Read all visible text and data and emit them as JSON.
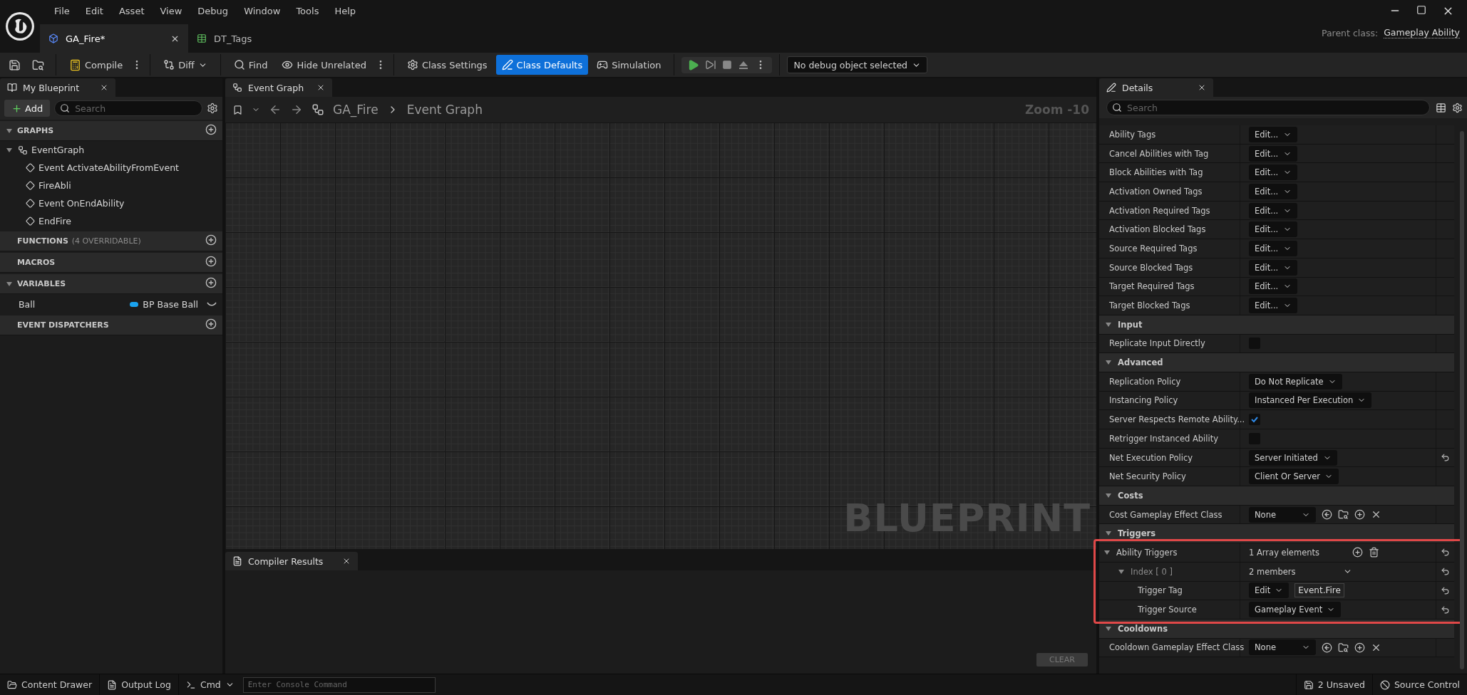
{
  "menu": [
    "File",
    "Edit",
    "Asset",
    "View",
    "Debug",
    "Window",
    "Tools",
    "Help"
  ],
  "doc_tabs": [
    {
      "label": "GA_Fire*",
      "selected": true
    },
    {
      "label": "DT_Tags",
      "selected": false
    }
  ],
  "parent_class": {
    "label": "Parent class:",
    "value": "Gameplay Ability"
  },
  "toolbar": {
    "compile": {
      "label": "Compile",
      "selected": false
    },
    "diff": {
      "label": "Diff",
      "selected": false
    },
    "find": {
      "label": "Find",
      "selected": false
    },
    "hide_unrelated": {
      "label": "Hide Unrelated",
      "selected": false
    },
    "class_settings": {
      "label": "Class Settings",
      "selected": false
    },
    "class_defaults": {
      "label": "Class Defaults",
      "selected": true
    },
    "simulation": {
      "label": "Simulation",
      "selected": false
    },
    "debug_object": "No debug object selected"
  },
  "my_blueprint": {
    "tab": "My Blueprint",
    "add": "Add",
    "search_placeholder": "Search",
    "sections": [
      {
        "title": "GRAPHS",
        "expanded": true,
        "graphs": [
          {
            "label": "EventGraph",
            "expanded": true,
            "children": [
              {
                "label": "Event ActivateAbilityFromEvent"
              },
              {
                "label": "FireAbli"
              },
              {
                "label": "Event OnEndAbility"
              },
              {
                "label": "EndFire"
              }
            ]
          }
        ]
      },
      {
        "title": "FUNCTIONS",
        "note": "(4 OVERRIDABLE)"
      },
      {
        "title": "MACROS"
      },
      {
        "title": "VARIABLES",
        "expanded": true,
        "variables": [
          {
            "name": "Ball",
            "type": "BP Base Ball",
            "color": "#1aa3f0"
          }
        ]
      },
      {
        "title": "EVENT DISPATCHERS"
      }
    ]
  },
  "graph": {
    "tab": "Event Graph",
    "breadcrumb": [
      "GA_Fire",
      "Event Graph"
    ],
    "zoom": "Zoom -10",
    "watermark": "BLUEPRINT"
  },
  "compiler": {
    "tab": "Compiler Results",
    "clear": "CLEAR"
  },
  "details": {
    "tab": "Details",
    "search_placeholder": "Search",
    "rows": [
      {
        "kind": "tag",
        "label": "Ability Tags",
        "value": "Edit..."
      },
      {
        "kind": "tag",
        "label": "Cancel Abilities with Tag",
        "value": "Edit..."
      },
      {
        "kind": "tag",
        "label": "Block Abilities with Tag",
        "value": "Edit..."
      },
      {
        "kind": "tag",
        "label": "Activation Owned Tags",
        "value": "Edit..."
      },
      {
        "kind": "tag",
        "label": "Activation Required Tags",
        "value": "Edit..."
      },
      {
        "kind": "tag",
        "label": "Activation Blocked Tags",
        "value": "Edit..."
      },
      {
        "kind": "tag",
        "label": "Source Required Tags",
        "value": "Edit..."
      },
      {
        "kind": "tag",
        "label": "Source Blocked Tags",
        "value": "Edit..."
      },
      {
        "kind": "tag",
        "label": "Target Required Tags",
        "value": "Edit..."
      },
      {
        "kind": "tag",
        "label": "Target Blocked Tags",
        "value": "Edit..."
      },
      {
        "kind": "category",
        "label": "Input",
        "expanded": true
      },
      {
        "kind": "checkbox",
        "label": "Replicate Input Directly",
        "checked": false
      },
      {
        "kind": "category",
        "label": "Advanced",
        "expanded": true
      },
      {
        "kind": "combo",
        "label": "Replication Policy",
        "value": "Do Not Replicate"
      },
      {
        "kind": "combo",
        "label": "Instancing Policy",
        "value": "Instanced Per Execution"
      },
      {
        "kind": "checkbox",
        "label": "Server Respects Remote Ability...",
        "checked": true
      },
      {
        "kind": "checkbox",
        "label": "Retrigger Instanced Ability",
        "checked": false
      },
      {
        "kind": "combo",
        "label": "Net Execution Policy",
        "value": "Server Initiated",
        "reset": true
      },
      {
        "kind": "combo",
        "label": "Net Security Policy",
        "value": "Client Or Server"
      },
      {
        "kind": "category",
        "label": "Costs",
        "expanded": true
      },
      {
        "kind": "class",
        "label": "Cost Gameplay Effect Class",
        "value": "None"
      },
      {
        "kind": "category",
        "label": "Triggers",
        "expanded": true
      },
      {
        "kind": "array",
        "label": "Ability Triggers",
        "value": "1 Array elements",
        "expanded": true,
        "reset": true,
        "highlighted": true,
        "children": [
          {
            "kind": "struct",
            "label": "Index [ 0 ]",
            "value": "2 members",
            "expanded": true,
            "reset": true,
            "children": [
              {
                "kind": "tag_value",
                "label": "Trigger Tag",
                "button": "Edit",
                "value": "Event.Fire",
                "reset": true
              },
              {
                "kind": "combo",
                "label": "Trigger Source",
                "value": "Gameplay Event",
                "reset": true
              }
            ]
          }
        ]
      },
      {
        "kind": "category",
        "label": "Cooldowns",
        "expanded": true
      },
      {
        "kind": "class",
        "label": "Cooldown Gameplay Effect Class",
        "value": "None"
      }
    ]
  },
  "status_bar": {
    "content_drawer": "Content Drawer",
    "output_log": "Output Log",
    "cmd": "Cmd",
    "console_placeholder": "Enter Console Command",
    "unsaved": "2 Unsaved",
    "source_control": "Source Control"
  }
}
